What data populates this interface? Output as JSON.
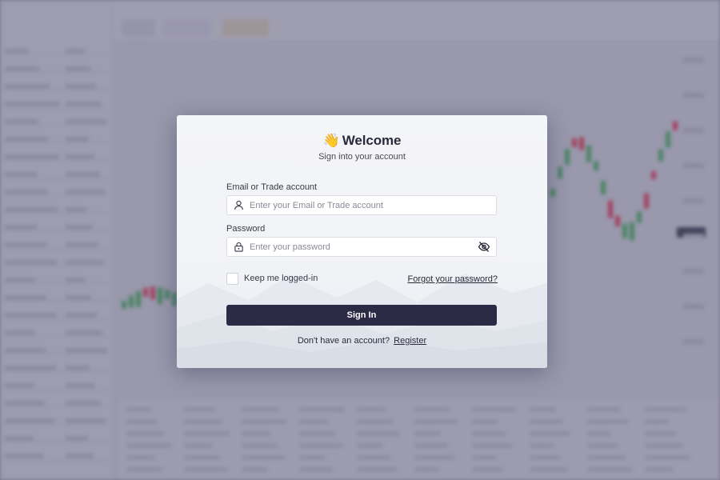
{
  "modal": {
    "title": "Welcome",
    "subtitle": "Sign into your account",
    "email": {
      "label": "Email or Trade account",
      "placeholder": "Enter your Email or Trade account",
      "value": ""
    },
    "password": {
      "label": "Password",
      "placeholder": "Enter your password",
      "value": ""
    },
    "remember_label": "Keep me logged-in",
    "remember_checked": false,
    "forgot_label": "Forgot your password?",
    "sign_in_label": "Sign In",
    "register_prompt": "Don't have an account?",
    "register_label": "Register"
  },
  "icons": {
    "greeting": "waving-hand-icon",
    "email_field": "user-icon",
    "password_field": "lock-icon",
    "password_toggle": "eye-off-icon"
  },
  "colors": {
    "primary_button": "#2c2a44",
    "overlay": "#4e4a6e",
    "candle_up": "#4caf62",
    "candle_down": "#e0405a"
  }
}
